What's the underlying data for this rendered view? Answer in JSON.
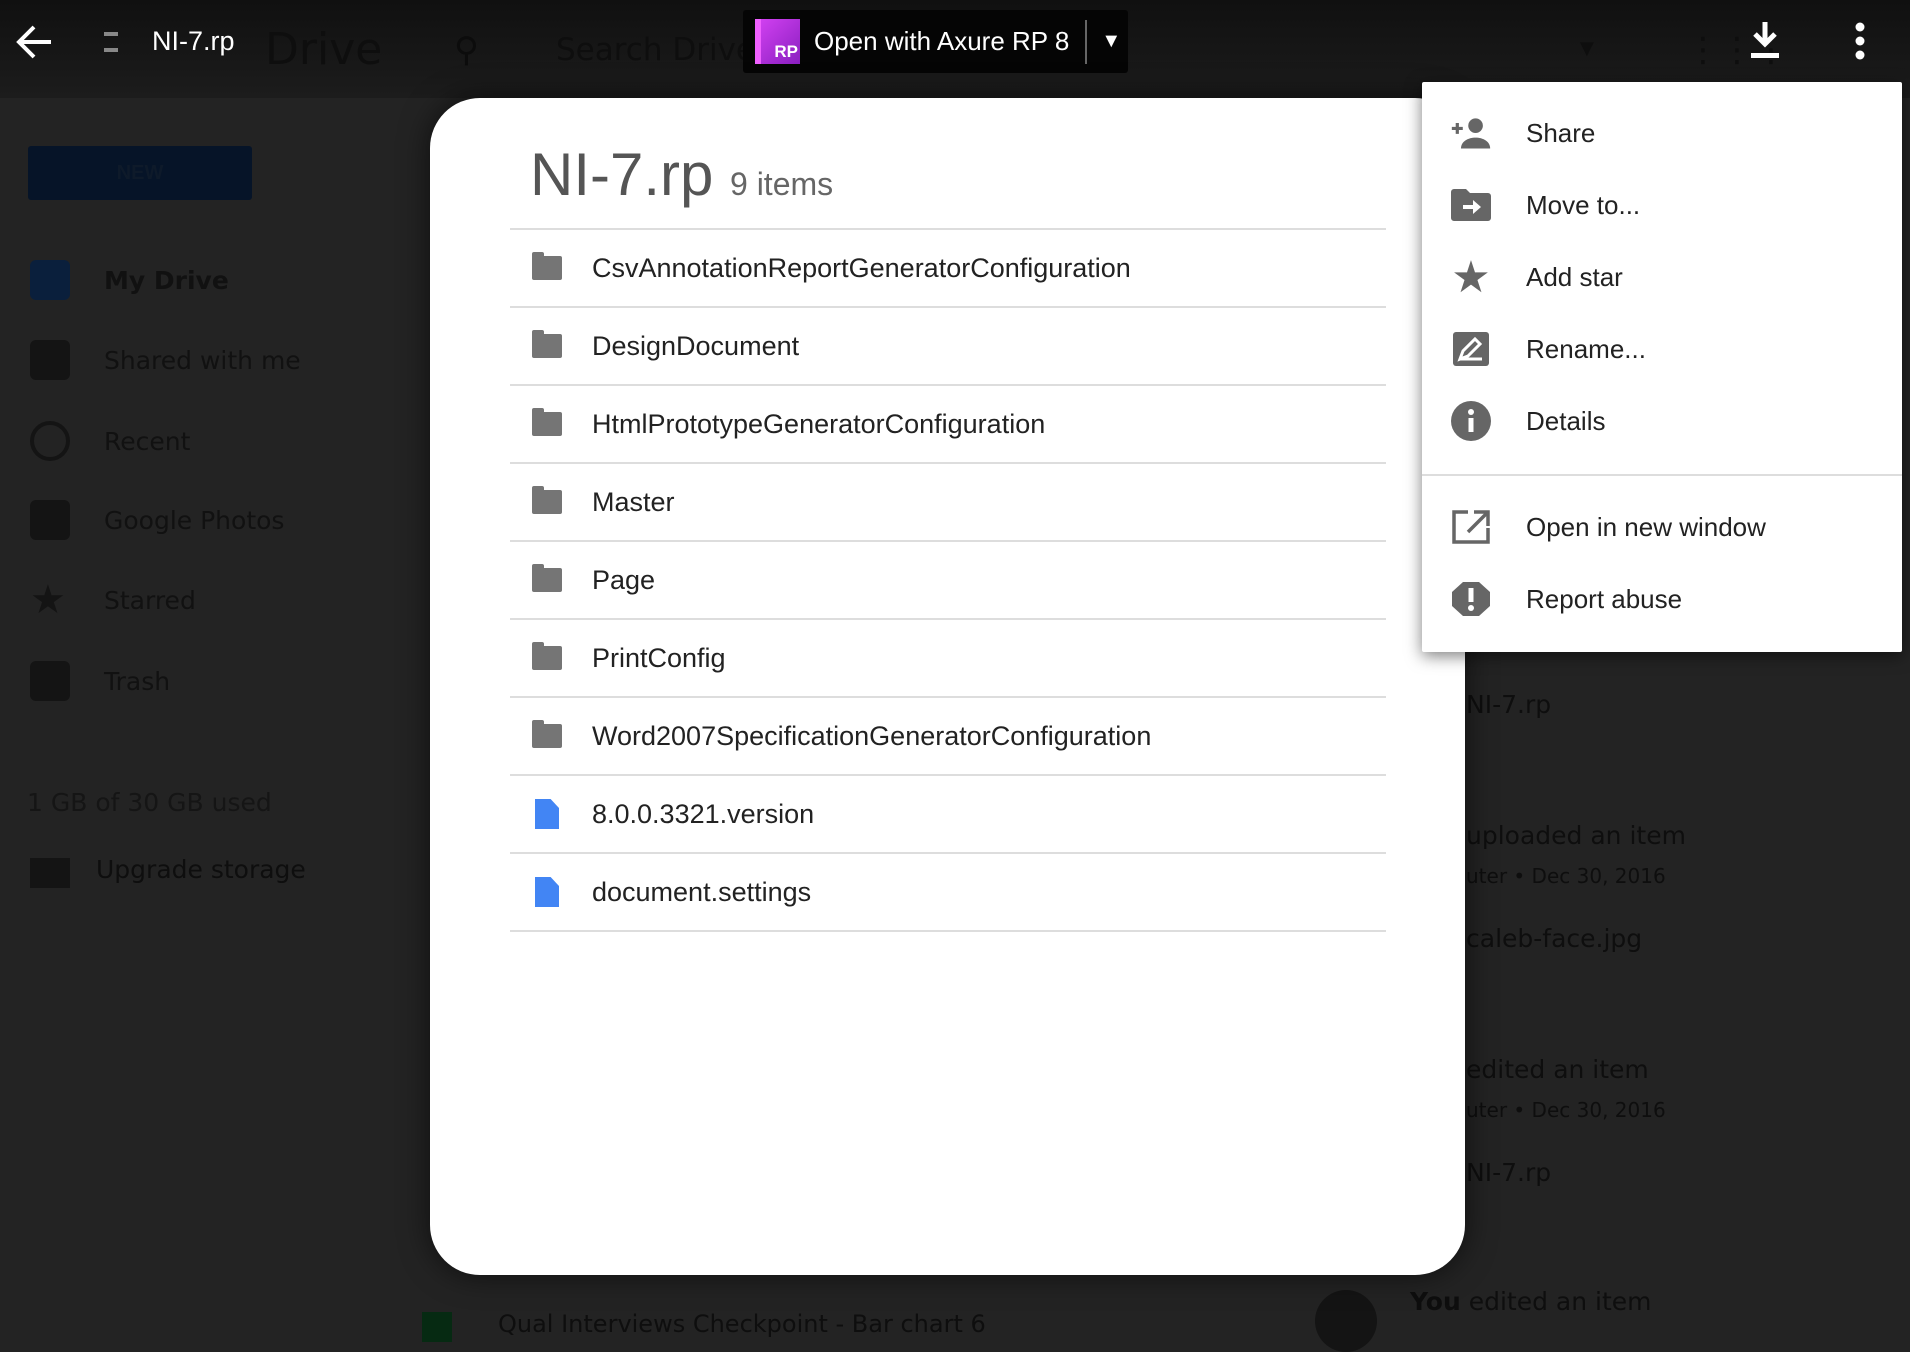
{
  "topbar": {
    "title": "NI-7.rp",
    "open_with_label": "Open with Axure RP 8",
    "app_badge": "RP",
    "bg_logo_text": "Drive",
    "bg_search_placeholder": "Search Drive"
  },
  "sidebar": {
    "new_label": "NEW",
    "items": [
      {
        "label": "My Drive",
        "icon": "drive-icon"
      },
      {
        "label": "Shared with me",
        "icon": "people-icon"
      },
      {
        "label": "Recent",
        "icon": "clock-icon"
      },
      {
        "label": "Google Photos",
        "icon": "pinwheel-icon"
      },
      {
        "label": "Starred",
        "icon": "star-icon"
      },
      {
        "label": "Trash",
        "icon": "trash-icon"
      }
    ],
    "storage": "1 GB of 30 GB used",
    "upgrade": "Upgrade storage"
  },
  "activity": {
    "a1_file": "NI-7.rp",
    "a2_action": "uploaded an item",
    "a2_meta": "uter • Dec 30, 2016",
    "a2_file": "caleb-face.jpg",
    "a3_action": "edited an item",
    "a3_meta": "uter • Dec 30, 2016",
    "a3_file": "NI-7.rp",
    "a4_who": "You",
    "a4_action": " edited an item"
  },
  "bg_file": "Qual Interviews Checkpoint - Bar chart 6",
  "dialog": {
    "title": "NI-7.rp",
    "count": "9 items",
    "items": [
      {
        "name": "CsvAnnotationReportGeneratorConfiguration",
        "type": "folder"
      },
      {
        "name": "DesignDocument",
        "type": "folder"
      },
      {
        "name": "HtmlPrototypeGeneratorConfiguration",
        "type": "folder"
      },
      {
        "name": "Master",
        "type": "folder"
      },
      {
        "name": "Page",
        "type": "folder"
      },
      {
        "name": "PrintConfig",
        "type": "folder"
      },
      {
        "name": "Word2007SpecificationGeneratorConfiguration",
        "type": "folder"
      },
      {
        "name": "8.0.0.3321.version",
        "type": "file"
      },
      {
        "name": "document.settings",
        "type": "file"
      }
    ]
  },
  "menu": {
    "items": [
      {
        "label": "Share",
        "icon": "person-add-icon"
      },
      {
        "label": "Move to...",
        "icon": "folder-move-icon"
      },
      {
        "label": "Add star",
        "icon": "star-icon"
      },
      {
        "label": "Rename...",
        "icon": "edit-icon"
      },
      {
        "label": "Details",
        "icon": "info-icon"
      },
      {
        "label": "Open in new window",
        "icon": "open-in-new-icon"
      },
      {
        "label": "Report abuse",
        "icon": "report-icon"
      }
    ]
  },
  "colors": {
    "badge": "#b832e0",
    "file_icon": "#4285f4",
    "menu_icon": "#666666"
  }
}
